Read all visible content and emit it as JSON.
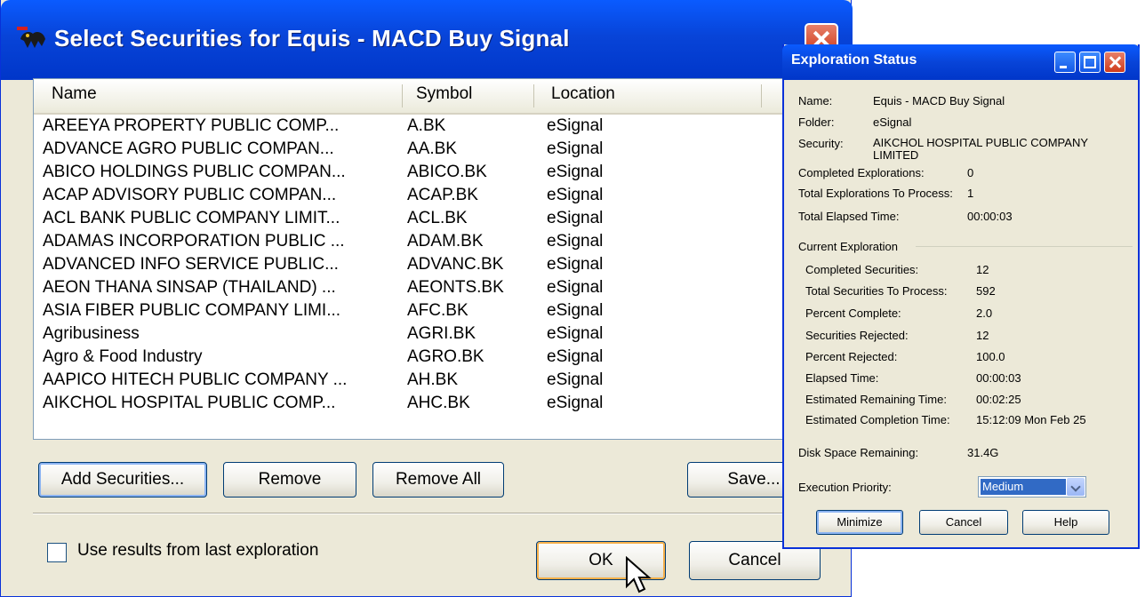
{
  "main_dialog": {
    "title": "Select Securities for Equis - MACD Buy Signal",
    "columns": [
      "Name",
      "Symbol",
      "Location"
    ],
    "rows": [
      {
        "name": "AREEYA PROPERTY PUBLIC COMP...",
        "symbol": "A.BK",
        "location": "eSignal"
      },
      {
        "name": "ADVANCE AGRO PUBLIC COMPAN...",
        "symbol": "AA.BK",
        "location": "eSignal"
      },
      {
        "name": "ABICO HOLDINGS PUBLIC COMPAN...",
        "symbol": "ABICO.BK",
        "location": "eSignal"
      },
      {
        "name": "ACAP ADVISORY PUBLIC COMPAN...",
        "symbol": "ACAP.BK",
        "location": "eSignal"
      },
      {
        "name": "ACL BANK PUBLIC COMPANY LIMIT...",
        "symbol": "ACL.BK",
        "location": "eSignal"
      },
      {
        "name": "ADAMAS INCORPORATION PUBLIC ...",
        "symbol": "ADAM.BK",
        "location": "eSignal"
      },
      {
        "name": "ADVANCED INFO SERVICE PUBLIC...",
        "symbol": "ADVANC.BK",
        "location": "eSignal"
      },
      {
        "name": "AEON THANA SINSAP (THAILAND) ...",
        "symbol": "AEONTS.BK",
        "location": "eSignal"
      },
      {
        "name": "ASIA FIBER PUBLIC COMPANY LIMI...",
        "symbol": "AFC.BK",
        "location": "eSignal"
      },
      {
        "name": "Agribusiness",
        "symbol": "AGRI.BK",
        "location": "eSignal"
      },
      {
        "name": "Agro & Food Industry",
        "symbol": "AGRO.BK",
        "location": "eSignal"
      },
      {
        "name": "AAPICO HITECH PUBLIC COMPANY ...",
        "symbol": "AH.BK",
        "location": "eSignal"
      },
      {
        "name": "AIKCHOL HOSPITAL PUBLIC COMP...",
        "symbol": "AHC.BK",
        "location": "eSignal"
      }
    ],
    "buttons": {
      "add_securities": "Add Securities...",
      "remove": "Remove",
      "remove_all": "Remove All",
      "save": "Save...",
      "ok": "OK",
      "cancel": "Cancel"
    },
    "use_results_label": "Use results from last exploration",
    "use_results_checked": false
  },
  "status_window": {
    "title": "Exploration Status",
    "name_label": "Name:",
    "name_value": "Equis - MACD Buy Signal",
    "folder_label": "Folder:",
    "folder_value": "eSignal",
    "security_label": "Security:",
    "security_value": "AIKCHOL HOSPITAL PUBLIC COMPANY LIMITED",
    "completed_explorations_label": "Completed Explorations:",
    "completed_explorations_value": "0",
    "total_explorations_label": "Total Explorations To Process:",
    "total_explorations_value": "1",
    "total_elapsed_label": "Total Elapsed Time:",
    "total_elapsed_value": "00:00:03",
    "current_group_label": "Current Exploration",
    "current": [
      {
        "label": "Completed Securities:",
        "value": "12"
      },
      {
        "label": "Total Securities To Process:",
        "value": "592"
      },
      {
        "label": "Percent Complete:",
        "value": "2.0"
      },
      {
        "label": "Securities Rejected:",
        "value": "12"
      },
      {
        "label": "Percent Rejected:",
        "value": "100.0"
      },
      {
        "label": "Elapsed Time:",
        "value": "00:00:03"
      },
      {
        "label": "Estimated Remaining Time:",
        "value": "00:02:25"
      },
      {
        "label": "Estimated Completion Time:",
        "value": "15:12:09 Mon Feb 25"
      }
    ],
    "disk_label": "Disk Space Remaining:",
    "disk_value": "31.4G",
    "priority_label": "Execution Priority:",
    "priority_value": "Medium",
    "buttons": {
      "minimize": "Minimize",
      "cancel": "Cancel",
      "help": "Help"
    }
  }
}
